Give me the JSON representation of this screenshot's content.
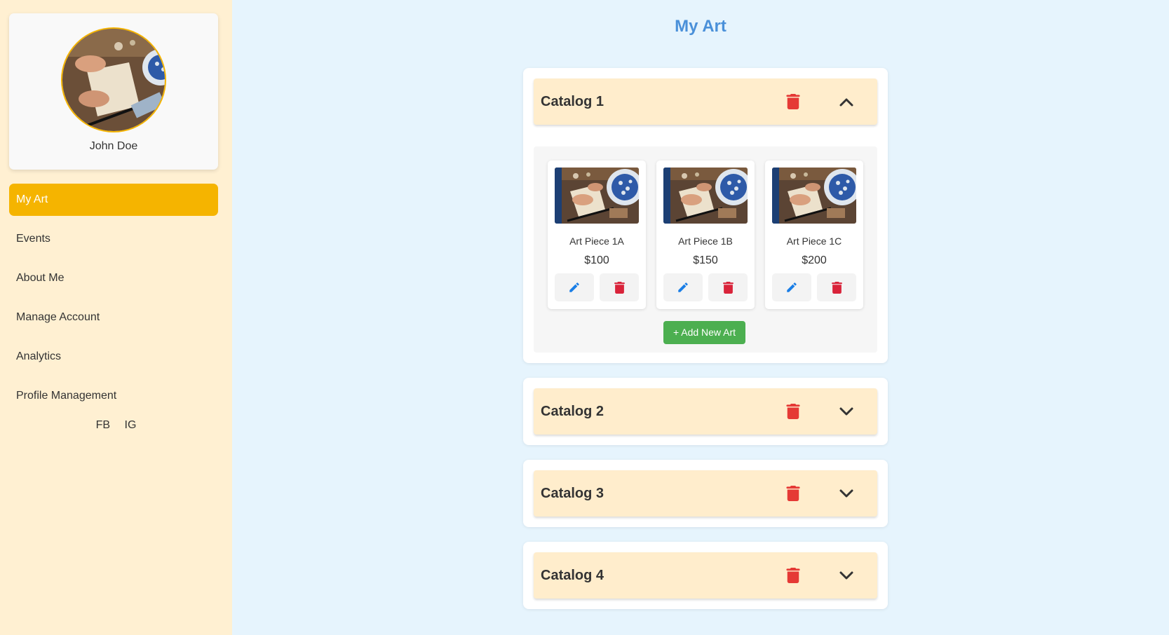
{
  "profile": {
    "name": "John Doe"
  },
  "nav": {
    "items": [
      {
        "label": "My Art",
        "active": true
      },
      {
        "label": "Events"
      },
      {
        "label": "About Me"
      },
      {
        "label": "Manage Account"
      },
      {
        "label": "Analytics"
      },
      {
        "label": "Profile Management"
      }
    ]
  },
  "social": {
    "fb": "FB",
    "ig": "IG"
  },
  "page": {
    "title": "My Art"
  },
  "catalogs": [
    {
      "title": "Catalog 1",
      "expanded": true,
      "toggle_icon": "chevron-up-icon",
      "delete_icon": "trash-icon",
      "art": [
        {
          "name": "Art Piece 1A",
          "price": "$100"
        },
        {
          "name": "Art Piece 1B",
          "price": "$150"
        },
        {
          "name": "Art Piece 1C",
          "price": "$200"
        }
      ],
      "add_label": "+ Add New Art"
    },
    {
      "title": "Catalog 2",
      "expanded": false,
      "toggle_icon": "chevron-down-icon",
      "delete_icon": "trash-icon"
    },
    {
      "title": "Catalog 3",
      "expanded": false,
      "toggle_icon": "chevron-down-icon",
      "delete_icon": "trash-icon"
    },
    {
      "title": "Catalog 4",
      "expanded": false,
      "toggle_icon": "chevron-down-icon",
      "delete_icon": "trash-icon"
    }
  ],
  "colors": {
    "sidebar_bg": "#fff0d2",
    "accent": "#f5b400",
    "main_bg": "#e6f4fd",
    "title": "#4a90d9",
    "catalog_header": "#ffedcc",
    "delete_red": "#e53935",
    "edit_blue": "#1a7ee6",
    "add_green": "#4caf50"
  }
}
